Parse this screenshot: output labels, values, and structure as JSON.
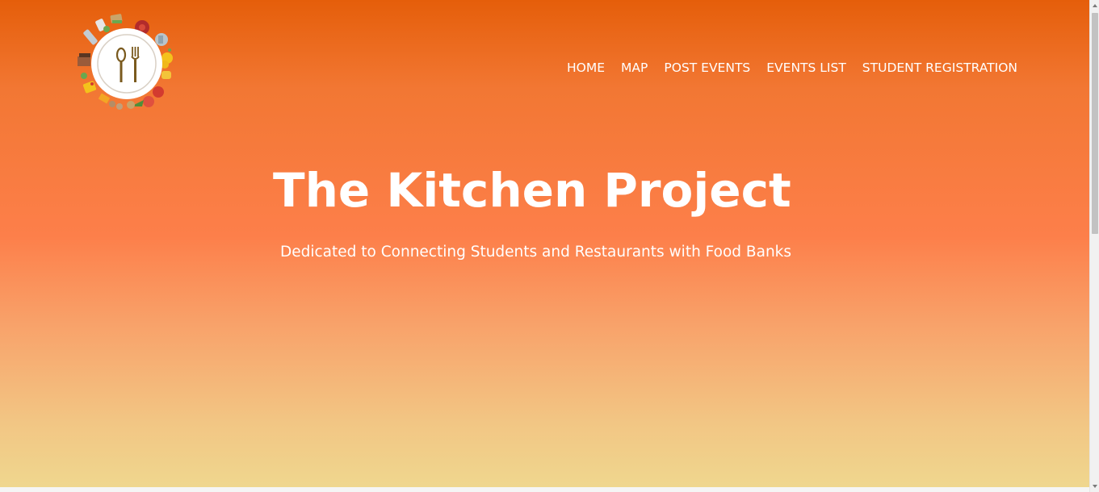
{
  "nav": {
    "items": [
      {
        "label": "HOME"
      },
      {
        "label": "MAP"
      },
      {
        "label": "POST EVENTS"
      },
      {
        "label": "EVENTS LIST"
      },
      {
        "label": "STUDENT REGISTRATION"
      }
    ]
  },
  "hero": {
    "title": "The Kitchen Project",
    "subtitle": "Dedicated to Connecting Students and Restaurants with Food Banks"
  },
  "logo": {
    "icon": "fork-and-spoon-plate-icon"
  },
  "colors": {
    "gradient_top": "#e55e0a",
    "gradient_mid": "#fd7f4a",
    "gradient_bottom": "#efd88f",
    "text": "#ffffff"
  }
}
